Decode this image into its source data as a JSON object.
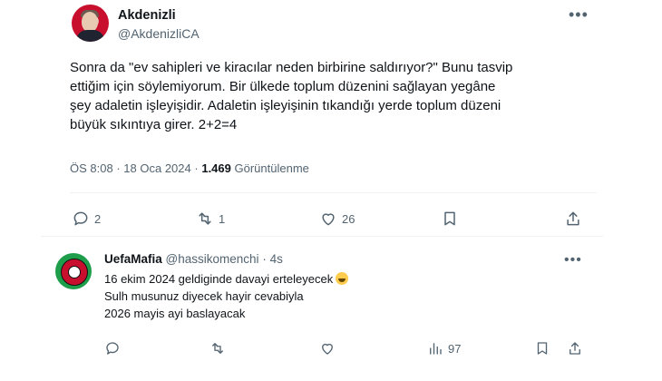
{
  "tweet": {
    "author_name": "Akdenizli",
    "author_handle": "@AkdenizliCA",
    "text_lines": [
      "Sonra da \"ev sahipleri ve kiracılar neden birbirine saldırıyor?\" Bunu tasvip",
      "ettiğim için söylemiyorum. Bir ülkede toplum düzenini sağlayan yegâne",
      "şey adaletin işleyişidir. Adaletin işleyişinin tıkandığı yerde toplum düzeni",
      "büyük sıkıntıya girer. 2+2=4"
    ],
    "time": "ÖS 8:08",
    "separator": "·",
    "date": "18 Oca 2024",
    "views_count": "1.469",
    "views_label": "Görüntülenme",
    "replies": "2",
    "reposts": "1",
    "likes": "26",
    "more_glyph": "•••"
  },
  "reply": {
    "author_name": "UefaMafia",
    "author_handle": "@hassikomenchi",
    "separator": "·",
    "time_ago": "4s",
    "text_lines": [
      "16 ekim 2024 geldiginde davayi erteleyecek",
      "Sulh musunuz diyecek hayir cevabiyla",
      "2026 mayis ayi baslayacak"
    ],
    "emoji": "rolling-on-the-floor-laughing-emoji",
    "views": "97",
    "more_glyph": "•••"
  },
  "colors": {
    "text": "#0f1419",
    "muted": "#536471",
    "divider": "#eff3f4"
  }
}
